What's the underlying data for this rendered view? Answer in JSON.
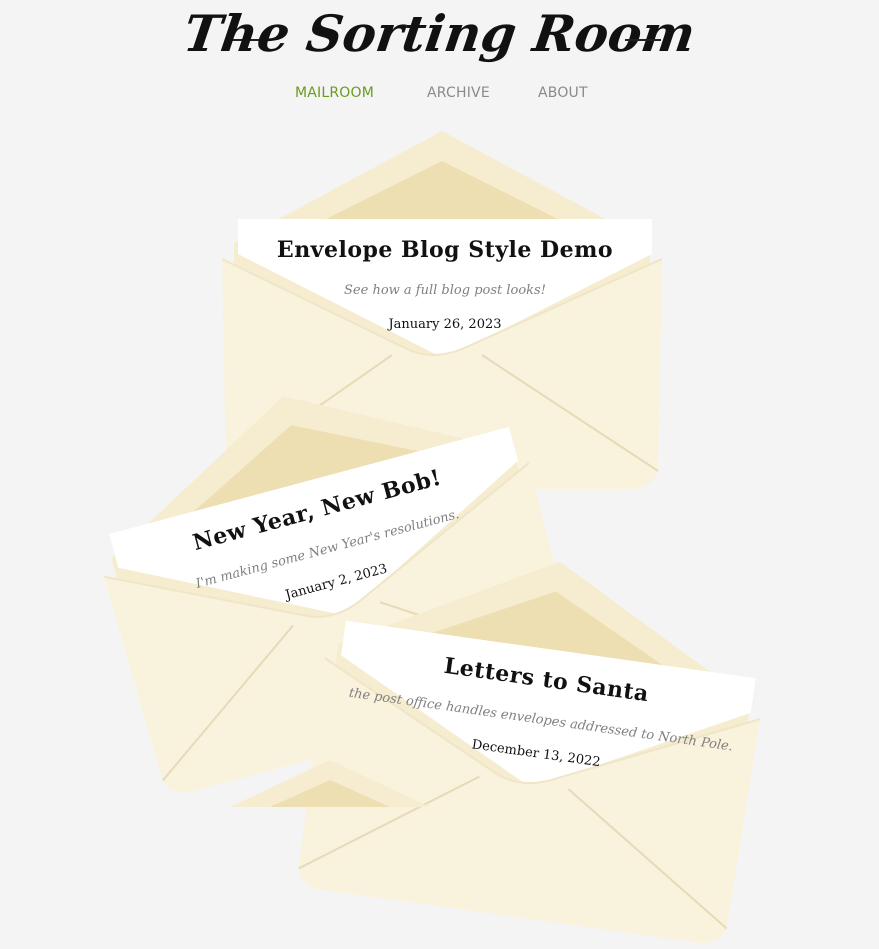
{
  "site": {
    "title": "The Sorting Room"
  },
  "nav": {
    "items": [
      {
        "label": "MAILROOM",
        "active": true
      },
      {
        "label": "ARCHIVE",
        "active": false
      },
      {
        "label": "ABOUT",
        "active": false
      }
    ]
  },
  "colors": {
    "accent": "#6b9a1f",
    "envelope": "#f8f0d9",
    "envelope_inner": "#efe1b6",
    "background": "#f4f4f4"
  },
  "posts": [
    {
      "title": "Envelope Blog Style Demo",
      "subtitle": "See how a full blog post looks!",
      "date": "January 26, 2023"
    },
    {
      "title": "New Year, New Bob!",
      "subtitle": "I'm making some New Year's resolutions.",
      "date": "January 2, 2023"
    },
    {
      "title": "Letters to Santa",
      "subtitle": "the post office handles envelopes addressed to North Pole.",
      "date": "December 13, 2022"
    }
  ]
}
